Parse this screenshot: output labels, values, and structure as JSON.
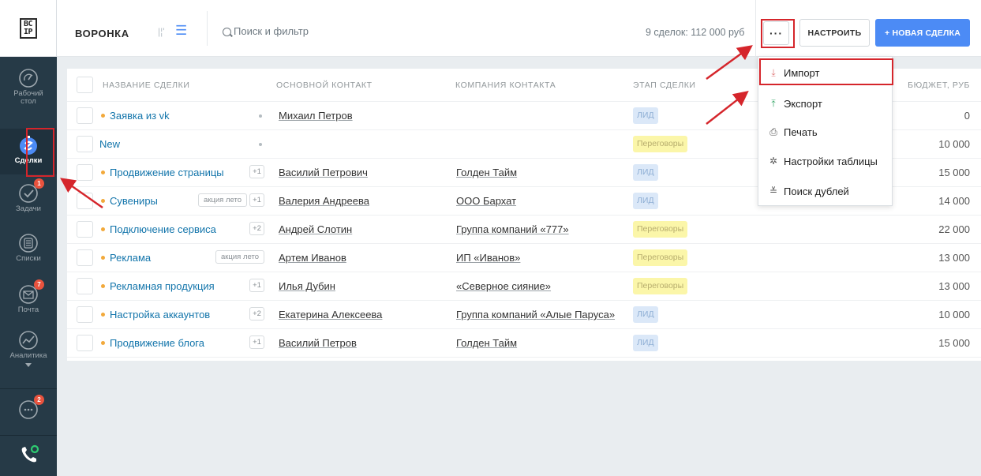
{
  "logo": {
    "line1": "BC",
    "line2": "IP"
  },
  "sidebar": {
    "items": [
      {
        "key": "desktop",
        "label": "Рабочий\nстол",
        "icon": "gauge-icon"
      },
      {
        "key": "deals",
        "label": "Сделки",
        "icon": "deals-icon",
        "active": true
      },
      {
        "key": "tasks",
        "label": "Задачи",
        "icon": "check-circle-icon",
        "badge": "1"
      },
      {
        "key": "lists",
        "label": "Списки",
        "icon": "list-icon"
      },
      {
        "key": "mail",
        "label": "Почта",
        "icon": "envelope-icon",
        "badge": "7"
      },
      {
        "key": "analytics",
        "label": "Аналитика",
        "icon": "chart-icon"
      }
    ],
    "chat_badge": "2"
  },
  "header": {
    "title": "ВОРОНКА",
    "search_placeholder": "Поиск и фильтр",
    "deal_count": "9 сделок: 112 000 руб",
    "more_label": "···",
    "configure_label": "НАСТРОИТЬ",
    "new_deal_label": "+ НОВАЯ СДЕЛКА"
  },
  "table": {
    "columns": [
      "НАЗВАНИЕ СДЕЛКИ",
      "ОСНОВНОЙ КОНТАКТ",
      "КОМПАНИЯ КОНТАКТА",
      "ЭТАП СДЕЛКИ",
      "БЮДЖЕТ, РУБ"
    ],
    "rows": [
      {
        "name": "Заявка из vk",
        "dot": true,
        "tags": [],
        "small_dot": true,
        "contact": "Михаил Петров",
        "company": "",
        "stage": "ЛИД",
        "stage_type": "lead",
        "budget": "0"
      },
      {
        "name": "New",
        "dot": false,
        "tags": [],
        "small_dot": true,
        "contact": "",
        "company": "",
        "stage": "Переговоры",
        "stage_type": "neg",
        "budget": "10 000"
      },
      {
        "name": "Продвижение страницы",
        "dot": true,
        "tags": [
          "+1"
        ],
        "small_dot": false,
        "contact": "Василий Петрович",
        "company": "Голден Тайм",
        "stage": "ЛИД",
        "stage_type": "lead",
        "budget": "15 000"
      },
      {
        "name": "Сувениры",
        "dot": true,
        "tags": [
          "акция лето",
          "+1"
        ],
        "small_dot": false,
        "contact": "Валерия Андреева",
        "company": "ООО Бархат",
        "stage": "ЛИД",
        "stage_type": "lead",
        "budget": "14 000"
      },
      {
        "name": "Подключение сервиса",
        "dot": true,
        "tags": [
          "+2"
        ],
        "small_dot": false,
        "contact": "Андрей Слотин",
        "company": "Группа компаний «777»",
        "stage": "Переговоры",
        "stage_type": "neg",
        "budget": "22 000"
      },
      {
        "name": "Реклама",
        "dot": true,
        "tags": [
          "акция лето"
        ],
        "small_dot": false,
        "contact": "Артем Иванов",
        "company": "ИП «Иванов»",
        "stage": "Переговоры",
        "stage_type": "neg",
        "budget": "13 000"
      },
      {
        "name": "Рекламная продукция",
        "dot": true,
        "tags": [
          "+1"
        ],
        "small_dot": false,
        "contact": "Илья Дубин",
        "company": "«Северное сияние»",
        "stage": "Переговоры",
        "stage_type": "neg",
        "budget": "13 000"
      },
      {
        "name": "Настройка аккаунтов",
        "dot": true,
        "tags": [
          "+2"
        ],
        "small_dot": false,
        "contact": "Екатерина Алексеева",
        "company": "Группа компаний «Алые Паруса»",
        "stage": "ЛИД",
        "stage_type": "lead",
        "budget": "10 000"
      },
      {
        "name": "Продвижение блога",
        "dot": true,
        "tags": [
          "+1"
        ],
        "small_dot": false,
        "contact": "Василий Петров",
        "company": "Голден Тайм",
        "stage": "ЛИД",
        "stage_type": "lead",
        "budget": "15 000"
      }
    ]
  },
  "dropdown": {
    "items": [
      {
        "label": "Импорт",
        "icon": "download-icon",
        "glyph": "⤓",
        "highlighted": true
      },
      {
        "label": "Экспорт",
        "icon": "upload-icon",
        "glyph": "⤒"
      },
      {
        "label": "Печать",
        "icon": "printer-icon",
        "glyph": "⎙"
      },
      {
        "label": "Настройки таблицы",
        "icon": "tools-icon",
        "glyph": "✲"
      },
      {
        "label": "Поиск дублей",
        "icon": "merge-icon",
        "glyph": "≚"
      }
    ]
  },
  "colors": {
    "sidebar_bg": "#263a47",
    "accent_blue": "#4c8bf5",
    "deal_link": "#1375ab",
    "annotation_red": "#d5252b",
    "lead_stage_bg": "#dbe8f8",
    "negotiation_stage_bg": "#fbf6a9"
  }
}
